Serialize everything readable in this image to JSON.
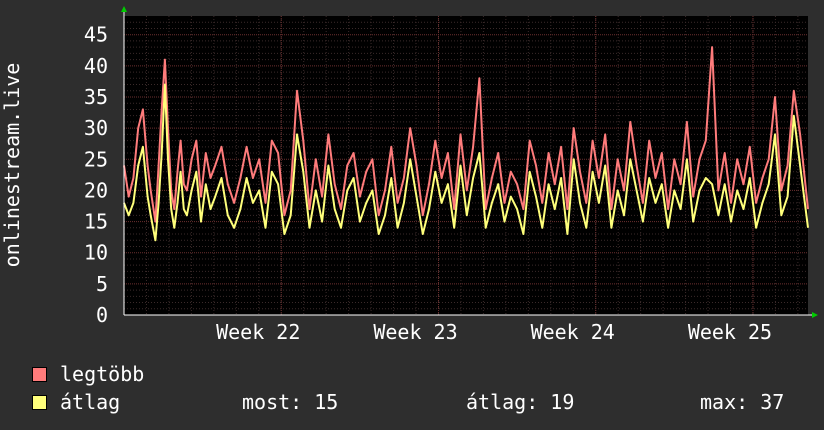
{
  "chart_data": {
    "type": "line",
    "ylabel": "onlinestream.live",
    "ylim": [
      0,
      48
    ],
    "yticks": [
      0,
      5,
      10,
      15,
      20,
      25,
      30,
      35,
      40,
      45
    ],
    "x_ticks": [
      "Week 22",
      "Week 23",
      "Week 24",
      "Week 25"
    ],
    "x_tick_positions_weeks": [
      1,
      2,
      3,
      4
    ],
    "x_range_weeks": [
      0,
      4.35
    ],
    "grid": true,
    "series": [
      {
        "name": "legtöbb",
        "color": "#ff7b7b",
        "x_weeks": [
          0,
          0.03,
          0.06,
          0.09,
          0.12,
          0.15,
          0.17,
          0.2,
          0.22,
          0.24,
          0.26,
          0.28,
          0.3,
          0.32,
          0.34,
          0.36,
          0.38,
          0.4,
          0.43,
          0.46,
          0.49,
          0.52,
          0.55,
          0.58,
          0.62,
          0.66,
          0.7,
          0.74,
          0.78,
          0.82,
          0.86,
          0.9,
          0.94,
          0.98,
          1.02,
          1.06,
          1.1,
          1.14,
          1.18,
          1.22,
          1.26,
          1.3,
          1.34,
          1.38,
          1.42,
          1.46,
          1.5,
          1.54,
          1.58,
          1.62,
          1.66,
          1.7,
          1.74,
          1.78,
          1.82,
          1.86,
          1.9,
          1.94,
          1.98,
          2.02,
          2.06,
          2.1,
          2.14,
          2.18,
          2.22,
          2.26,
          2.3,
          2.34,
          2.38,
          2.42,
          2.46,
          2.5,
          2.54,
          2.58,
          2.62,
          2.66,
          2.7,
          2.74,
          2.78,
          2.82,
          2.86,
          2.9,
          2.94,
          2.98,
          3.02,
          3.06,
          3.1,
          3.14,
          3.18,
          3.22,
          3.26,
          3.3,
          3.34,
          3.38,
          3.42,
          3.46,
          3.5,
          3.54,
          3.58,
          3.62,
          3.66,
          3.7,
          3.74,
          3.78,
          3.82,
          3.86,
          3.9,
          3.94,
          3.98,
          4.02,
          4.06,
          4.1,
          4.14,
          4.18,
          4.22,
          4.26,
          4.3,
          4.35
        ],
        "y": [
          24,
          19,
          22,
          30,
          33,
          24,
          20,
          15,
          24,
          33,
          41,
          30,
          20,
          17,
          23,
          28,
          21,
          20,
          25,
          28,
          19,
          26,
          22,
          24,
          27,
          21,
          18,
          22,
          27,
          22,
          25,
          18,
          28,
          26,
          16,
          20,
          36,
          28,
          17,
          25,
          19,
          29,
          21,
          17,
          24,
          26,
          19,
          23,
          25,
          16,
          20,
          27,
          18,
          22,
          30,
          24,
          16,
          21,
          28,
          22,
          26,
          17,
          29,
          20,
          27,
          38,
          17,
          22,
          26,
          18,
          23,
          21,
          17,
          28,
          24,
          18,
          26,
          21,
          27,
          17,
          30,
          23,
          18,
          28,
          22,
          29,
          17,
          25,
          20,
          31,
          24,
          18,
          28,
          22,
          26,
          17,
          25,
          21,
          31,
          19,
          25,
          28,
          43,
          20,
          26,
          18,
          25,
          21,
          27,
          18,
          22,
          25,
          35,
          20,
          24,
          36,
          29,
          17
        ],
        "values_note": ""
      },
      {
        "name": "átlag",
        "color": "#ffff7b",
        "x_weeks": [
          0,
          0.03,
          0.06,
          0.09,
          0.12,
          0.15,
          0.17,
          0.2,
          0.22,
          0.24,
          0.26,
          0.28,
          0.3,
          0.32,
          0.34,
          0.36,
          0.38,
          0.4,
          0.43,
          0.46,
          0.49,
          0.52,
          0.55,
          0.58,
          0.62,
          0.66,
          0.7,
          0.74,
          0.78,
          0.82,
          0.86,
          0.9,
          0.94,
          0.98,
          1.02,
          1.06,
          1.1,
          1.14,
          1.18,
          1.22,
          1.26,
          1.3,
          1.34,
          1.38,
          1.42,
          1.46,
          1.5,
          1.54,
          1.58,
          1.62,
          1.66,
          1.7,
          1.74,
          1.78,
          1.82,
          1.86,
          1.9,
          1.94,
          1.98,
          2.02,
          2.06,
          2.1,
          2.14,
          2.18,
          2.22,
          2.26,
          2.3,
          2.34,
          2.38,
          2.42,
          2.46,
          2.5,
          2.54,
          2.58,
          2.62,
          2.66,
          2.7,
          2.74,
          2.78,
          2.82,
          2.86,
          2.9,
          2.94,
          2.98,
          3.02,
          3.06,
          3.1,
          3.14,
          3.18,
          3.22,
          3.26,
          3.3,
          3.34,
          3.38,
          3.42,
          3.46,
          3.5,
          3.54,
          3.58,
          3.62,
          3.66,
          3.7,
          3.74,
          3.78,
          3.82,
          3.86,
          3.9,
          3.94,
          3.98,
          4.02,
          4.06,
          4.1,
          4.14,
          4.18,
          4.22,
          4.26,
          4.3,
          4.35
        ],
        "y": [
          18,
          16,
          18,
          24,
          27,
          19,
          16,
          12,
          18,
          26,
          37,
          25,
          17,
          14,
          18,
          23,
          17,
          16,
          20,
          23,
          15,
          21,
          17,
          19,
          22,
          16,
          14,
          17,
          22,
          18,
          20,
          14,
          23,
          21,
          13,
          16,
          29,
          23,
          14,
          20,
          15,
          24,
          17,
          14,
          20,
          22,
          15,
          18,
          20,
          13,
          16,
          22,
          14,
          18,
          25,
          19,
          13,
          17,
          23,
          18,
          21,
          14,
          24,
          16,
          22,
          26,
          14,
          18,
          21,
          15,
          19,
          17,
          13,
          23,
          19,
          14,
          21,
          17,
          22,
          13,
          25,
          18,
          14,
          23,
          18,
          24,
          14,
          20,
          16,
          25,
          20,
          15,
          22,
          18,
          21,
          14,
          20,
          17,
          25,
          15,
          20,
          22,
          21,
          16,
          21,
          15,
          20,
          17,
          22,
          14,
          18,
          21,
          29,
          16,
          19,
          32,
          24,
          14
        ],
        "values_note": ""
      }
    ]
  },
  "legend": {
    "max_label": "legtöbb",
    "avg_label": "átlag",
    "max_color": "#ff7b7b",
    "avg_color": "#ffff7b"
  },
  "stats": {
    "now": "most: 15",
    "avg": "átlag: 19",
    "max": "max: 37"
  }
}
